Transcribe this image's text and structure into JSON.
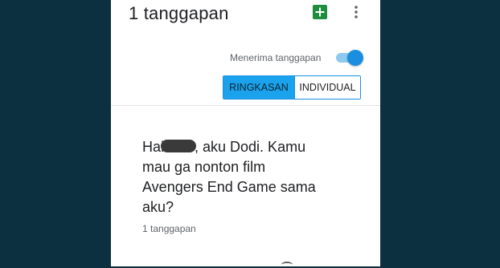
{
  "header": {
    "title": "1 tanggapan",
    "icons": [
      "sheets-icon",
      "more-vert-icon"
    ]
  },
  "settings": {
    "accept_label": "Menerima tanggapan",
    "accept_toggle_on": true
  },
  "tabs": [
    {
      "label": "RINGKASAN",
      "active": true
    },
    {
      "label": "INDIVIDUAL",
      "active": false
    }
  ],
  "question": {
    "text_before": "Hai",
    "text_after": ", aku Dodi. Kamu mau ga nonton film Avengers End Game sama aku?",
    "response_count": "1 tanggapan"
  },
  "colors": {
    "background": "#0d3040",
    "accent": "#1a8fe0",
    "active_tab": "#1aa3ec",
    "sheets_green": "#1e8e3e"
  }
}
